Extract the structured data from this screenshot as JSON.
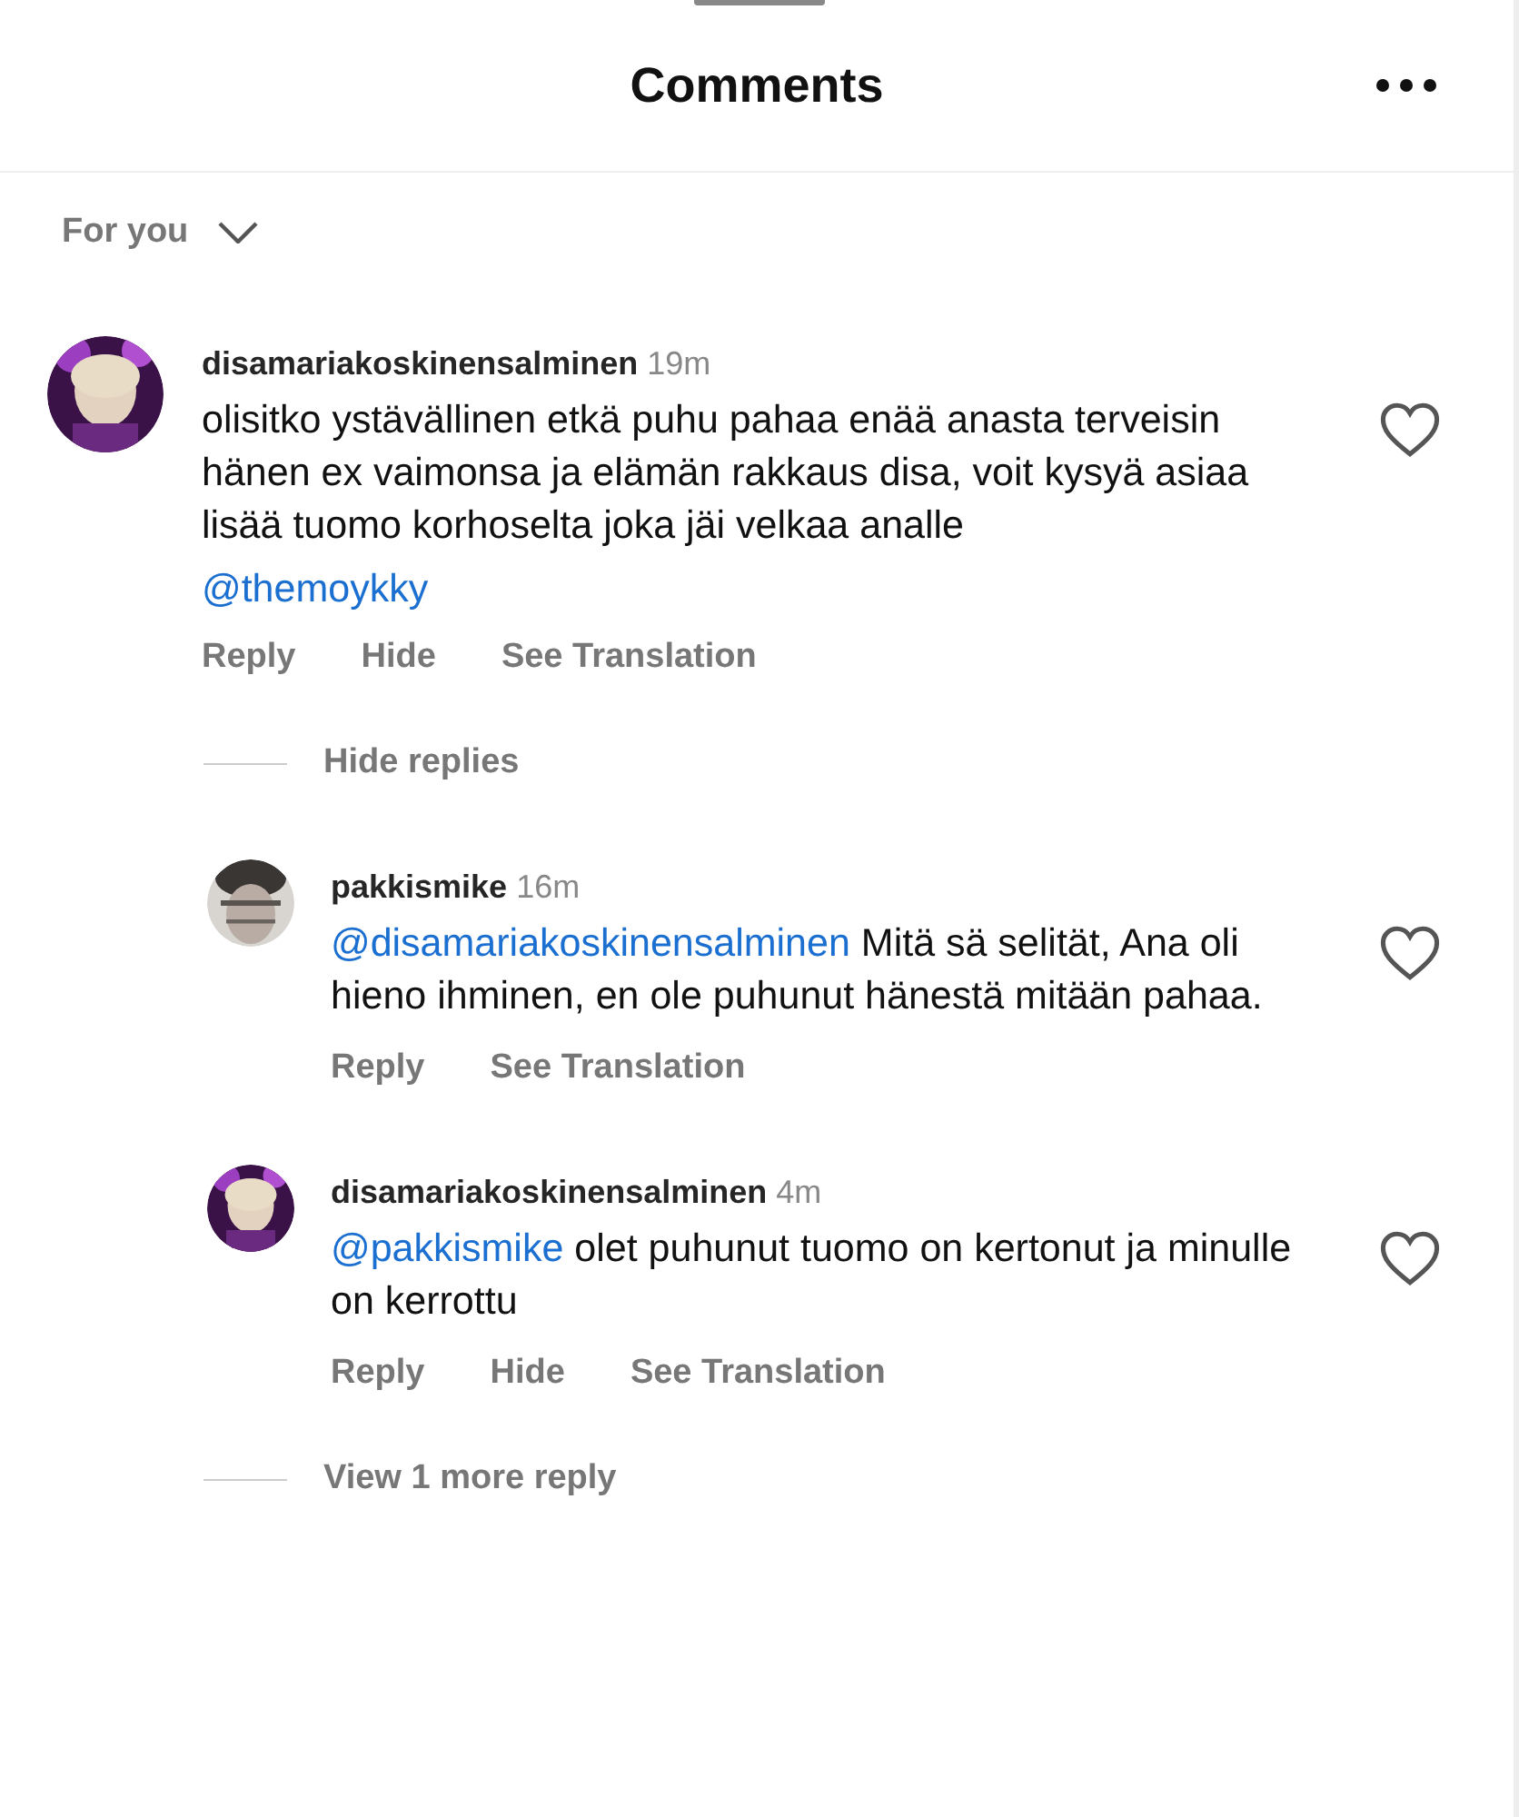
{
  "header": {
    "title": "Comments"
  },
  "sort": {
    "label": "For you"
  },
  "comments": [
    {
      "username": "disamariakoskinensalminen",
      "time": "19m",
      "text": "olisitko ystävällinen etkä puhu pahaa enää anasta terveisin hänen ex vaimonsa ja elämän rakkaus disa, voit kysyä asiaa lisää tuomo korhoselta joka jäi velkaa analle",
      "mention_line": "@themoykky",
      "liked": false,
      "actions": [
        "Reply",
        "Hide",
        "See Translation"
      ],
      "replies_toggle": "Hide replies",
      "replies": [
        {
          "username": "pakkismike",
          "time": "16m",
          "mention": "@disamariakoskinensalminen",
          "text": "Mitä sä selität, Ana oli hieno ihminen, en ole puhunut hänestä mitään pahaa.",
          "liked": false,
          "actions": [
            "Reply",
            "See Translation"
          ]
        },
        {
          "username": "disamariakoskinensalminen",
          "time": "4m",
          "mention": "@pakkismike",
          "text": "olet puhunut tuomo on kertonut ja minulle on kerrottu",
          "liked": false,
          "actions": [
            "Reply",
            "Hide",
            "See Translation"
          ]
        }
      ],
      "more_replies": "View 1 more reply"
    }
  ]
}
